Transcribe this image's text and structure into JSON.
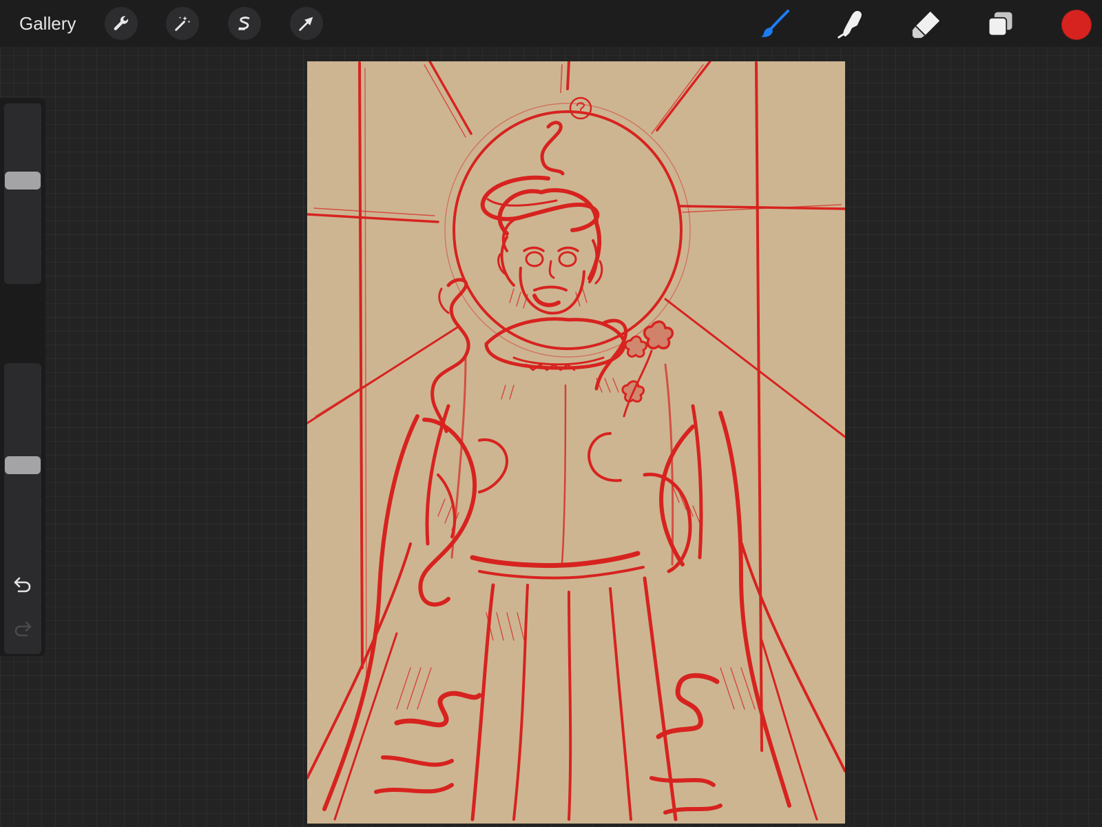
{
  "app": {
    "gallery_label": "Gallery"
  },
  "toolbar": {
    "left_actions": [
      {
        "name": "actions",
        "icon": "wrench-icon"
      },
      {
        "name": "adjustments",
        "icon": "magic-wand-icon"
      },
      {
        "name": "selection",
        "icon": "selection-s-icon"
      },
      {
        "name": "transform",
        "icon": "arrow-cursor-icon"
      }
    ],
    "tools": [
      {
        "name": "brush",
        "icon": "brush-icon",
        "active": true
      },
      {
        "name": "smudge",
        "icon": "smudge-finger-icon",
        "active": false
      },
      {
        "name": "eraser",
        "icon": "eraser-icon",
        "active": false
      },
      {
        "name": "layers",
        "icon": "layers-icon",
        "active": false
      }
    ],
    "active_tool_color": "#1e7cf2",
    "inactive_tool_color": "#f0f0f0",
    "current_color": "#d7231f"
  },
  "sidebar": {
    "brush_size_level": 0.58,
    "opacity_level": 0.66,
    "modify_button_icon": "square-icon",
    "undo_icon": "undo-arrow-icon",
    "redo_icon": "redo-arrow-icon",
    "redo_enabled": false
  },
  "canvas": {
    "paper_color": "#cdb592",
    "ink_color": "#d7231f",
    "subject": "sketch-of-figure-with-halo-and-snakes"
  }
}
